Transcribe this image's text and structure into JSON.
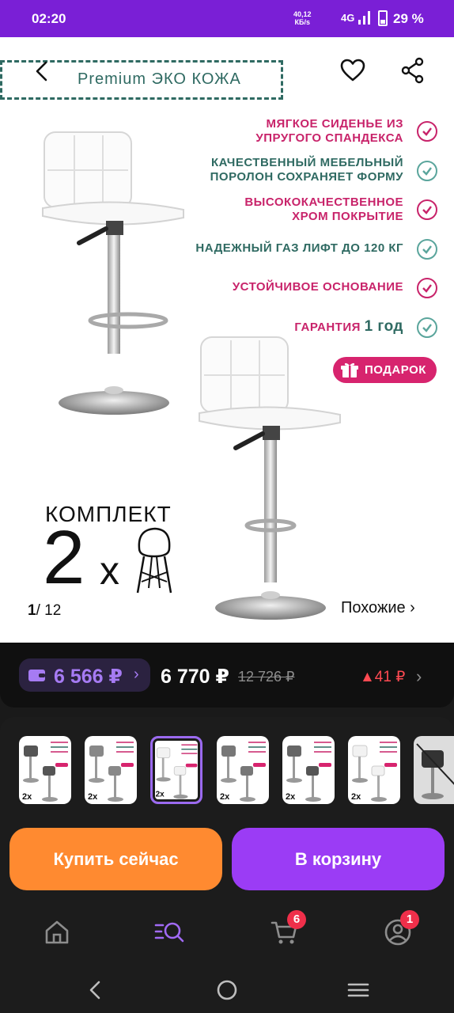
{
  "status_bar": {
    "time": "02:20",
    "speed_value": "40,12",
    "speed_unit": "КБ/s",
    "network": "4G",
    "battery": "29 %"
  },
  "hero": {
    "banner_text": "Premium ЭКО КОЖА",
    "features": [
      {
        "line1": "МЯГКОЕ СИДЕНЬЕ ИЗ",
        "line2": "УПРУГОГО СПАНДЕКСА",
        "color": "#c8236a"
      },
      {
        "line1": "КАЧЕСТВЕННЫЙ МЕБЕЛЬНЫЙ",
        "line2": "ПОРОЛОН СОХРАНЯЕТ ФОРМУ",
        "color": "#2f6a62"
      },
      {
        "line1": "ВЫСОКОКАЧЕСТВЕННОЕ",
        "line2": "ХРОМ ПОКРЫТИЕ",
        "color": "#c8236a"
      },
      {
        "line1": "НАДЕЖНЫЙ ГАЗ ЛИФТ ДО 120 КГ",
        "line2": "",
        "color": "#2f6a62"
      },
      {
        "line1": "УСТОЙЧИВОЕ ОСНОВАНИЕ",
        "line2": "",
        "color": "#c8236a"
      }
    ],
    "warranty_prefix": "ГАРАНТИЯ",
    "warranty_value": "1 год",
    "gift_label": "ПОДАРОК",
    "set_label": "КОМПЛЕКТ",
    "set_count": "2",
    "set_times": "x",
    "page_current": "1",
    "page_total": "/ 12",
    "similar_label": "Похожие ›"
  },
  "price": {
    "wallet_price": "6 566 ₽",
    "wallet_chevron": "›",
    "current": "6 770 ₽",
    "old": "12 726 ₽",
    "diff": "▲41 ₽",
    "chevron": "›",
    "accent": "#a67bf3"
  },
  "thumbnails": {
    "count": 7,
    "selected_index": 2
  },
  "actions": {
    "buy_now": "Купить сейчас",
    "add_to_cart": "В корзину"
  },
  "bottom_nav": {
    "cart_badge": "6",
    "profile_badge": "1"
  },
  "icons": {
    "back": "back-arrow-icon",
    "favorite": "heart-icon",
    "share": "share-icon",
    "gift": "gift-icon",
    "wallet": "wallet-icon",
    "home": "home-icon",
    "catalog": "catalog-search-icon",
    "cart": "cart-icon",
    "profile": "profile-icon"
  }
}
